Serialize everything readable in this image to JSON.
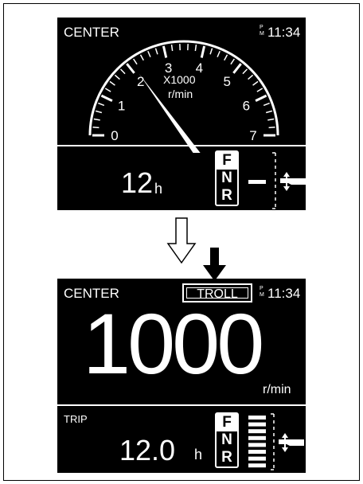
{
  "screen1": {
    "title": "CENTER",
    "ampm": "P\nM",
    "time": "11:34",
    "tach": {
      "ticks": [
        "0",
        "1",
        "2",
        "3",
        "4",
        "5",
        "6",
        "7"
      ],
      "unit_multiplier": "X1000",
      "unit": "r/min",
      "needle_value": 2.1,
      "max": 7
    },
    "hours_value": "12",
    "hours_unit": "h",
    "gears": [
      "F",
      "N",
      "R"
    ],
    "selected_gear": "F"
  },
  "screen2": {
    "title": "CENTER",
    "troll_label": "TROLL",
    "ampm": "P\nM",
    "time": "11:34",
    "rpm_value": "1000",
    "rpm_unit": "r/min",
    "trip_label": "TRIP",
    "trip_value": "12.0",
    "trip_unit": "h",
    "gears": [
      "F",
      "N",
      "R"
    ],
    "selected_gear": "F",
    "trim_segments_total": 8
  }
}
